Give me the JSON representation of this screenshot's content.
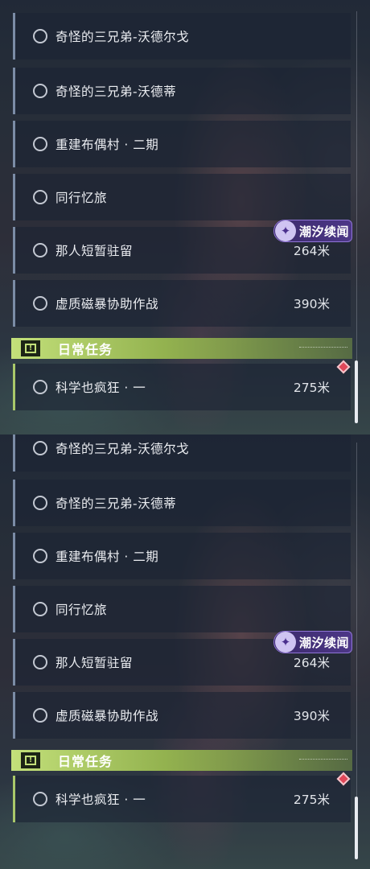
{
  "panels": [
    {
      "quests": [
        {
          "label": "奇怪的三兄弟-沃德尔戈",
          "distance": ""
        },
        {
          "label": "奇怪的三兄弟-沃德蒂",
          "distance": ""
        },
        {
          "label": "重建布偶村 · 二期",
          "distance": ""
        },
        {
          "label": "同行忆旅",
          "distance": ""
        },
        {
          "label": "那人短暂驻留",
          "distance": "264米"
        },
        {
          "label": "虚质磁暴协助作战",
          "distance": "390米"
        }
      ],
      "badge": {
        "icon": "tide-event-icon",
        "label": "潮汐续闻"
      },
      "daily_section": {
        "title": "日常任务",
        "icon": "exclamation-icon"
      },
      "daily_quests": [
        {
          "label": "科学也疯狂 · 一",
          "distance": "275米"
        }
      ]
    },
    {
      "quests": [
        {
          "label": "奇怪的三兄弟-沃德尔戈",
          "distance": ""
        },
        {
          "label": "奇怪的三兄弟-沃德蒂",
          "distance": ""
        },
        {
          "label": "重建布偶村 · 二期",
          "distance": ""
        },
        {
          "label": "同行忆旅",
          "distance": ""
        },
        {
          "label": "那人短暂驻留",
          "distance": "264米"
        },
        {
          "label": "虚质磁暴协助作战",
          "distance": "390米"
        }
      ],
      "badge": {
        "icon": "tide-event-icon",
        "label": "潮汐续闻"
      },
      "daily_section": {
        "title": "日常任务",
        "icon": "exclamation-icon"
      },
      "daily_quests": [
        {
          "label": "科学也疯狂 · 一",
          "distance": "275米"
        }
      ]
    }
  ],
  "colors": {
    "quest_accent": "#7b8ca6",
    "daily_accent": "#a9c86a",
    "badge": "#4d3788",
    "tracked_marker": "#e0485a"
  }
}
